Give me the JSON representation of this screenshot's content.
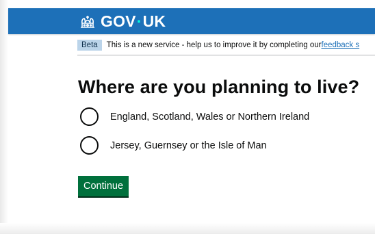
{
  "header": {
    "logo_prefix": "GOV",
    "logo_dot": "·",
    "logo_suffix": "UK",
    "logo_icon": "crown-icon",
    "background_color": "#1d70b8"
  },
  "phase_banner": {
    "tag": "Beta",
    "text": "This is a new service - help us to improve it by completing our ",
    "link_text": "feedback s"
  },
  "page": {
    "title": "Where are you planning to live?"
  },
  "options": [
    {
      "label": "England, Scotland, Wales or Northern Ireland",
      "selected": false
    },
    {
      "label": "Jersey, Guernsey or the Isle of Man",
      "selected": false
    }
  ],
  "actions": {
    "continue_label": "Continue",
    "button_color": "#00703c"
  }
}
